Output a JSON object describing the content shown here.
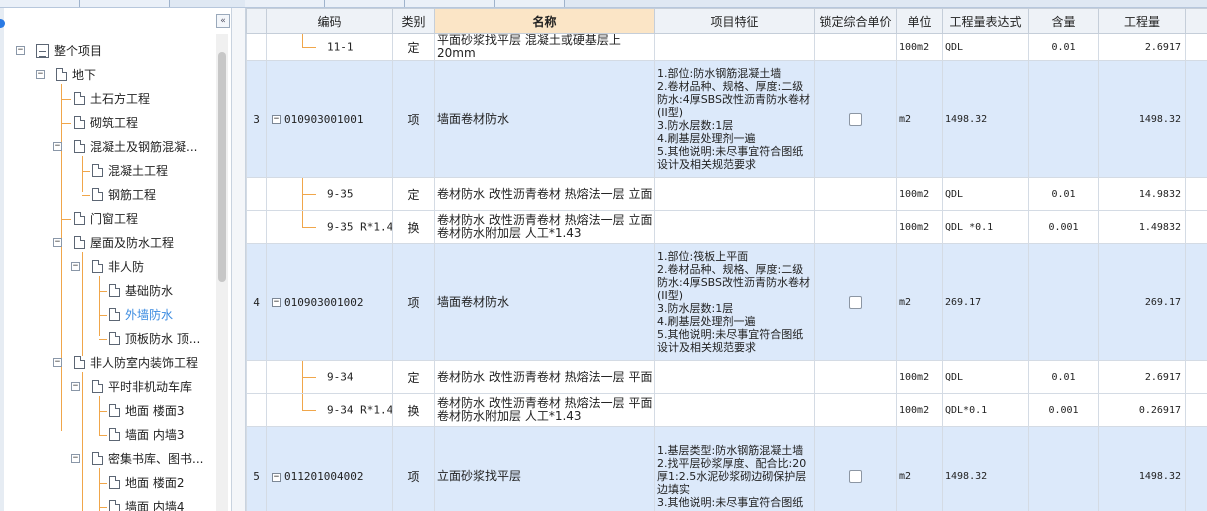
{
  "tree": {
    "collapse_glyph": "«",
    "items": [
      {
        "label": "整个项目",
        "toggle": "−"
      },
      {
        "label": "地下",
        "toggle": "−"
      },
      {
        "label": "土石方工程"
      },
      {
        "label": "砌筑工程"
      },
      {
        "label": "混凝土及钢筋混凝...",
        "toggle": "−"
      },
      {
        "label": "混凝土工程"
      },
      {
        "label": "钢筋工程"
      },
      {
        "label": "门窗工程"
      },
      {
        "label": "屋面及防水工程",
        "toggle": "−"
      },
      {
        "label": "非人防",
        "toggle": "−"
      },
      {
        "label": "基础防水"
      },
      {
        "label": "外墙防水",
        "active": true
      },
      {
        "label": "顶板防水 顶..."
      },
      {
        "label": "非人防室内装饰工程",
        "toggle": "−"
      },
      {
        "label": "平时非机动车库",
        "toggle": "−"
      },
      {
        "label": "地面 楼面3"
      },
      {
        "label": "墙面 内墙3"
      },
      {
        "label": "密集书库、图书...",
        "toggle": "−"
      },
      {
        "label": "地面 楼面2"
      },
      {
        "label": "墙面 内墙4"
      }
    ]
  },
  "grid": {
    "headers": {
      "code": "编码",
      "type": "类别",
      "name": "名称",
      "feature": "项目特征",
      "lock": "锁定综合单价",
      "unit": "单位",
      "expr": "工程量表达式",
      "qty": "含量",
      "amount": "工程量"
    },
    "rows": [
      {
        "num": "",
        "code": "11-1",
        "type": "定",
        "name": "平面砂浆找平层 混凝土或硬基层上 20mm",
        "feature": "",
        "unit": "100m2",
        "expr": "QDL",
        "qty": "0.01",
        "amount": "2.6917"
      },
      {
        "num": "3",
        "code": "010903001001",
        "type": "项",
        "name": "墙面卷材防水",
        "feature": "1.部位:防水钢筋混凝土墙\n2.卷材品种、规格、厚度:二级防水:4厚SBS改性沥青防水卷材(II型)\n3.防水层数:1层\n4.刷基层处理剂一遍\n5.其他说明:未尽事宜符合图纸设计及相关规范要求",
        "unit": "m2",
        "expr": "1498.32",
        "qty": "",
        "amount": "1498.32"
      },
      {
        "num": "",
        "code": "9-35",
        "type": "定",
        "name": "卷材防水 改性沥青卷材 热熔法一层 立面",
        "feature": "",
        "unit": "100m2",
        "expr": "QDL",
        "qty": "0.01",
        "amount": "14.9832"
      },
      {
        "num": "",
        "code": "9-35 R*1.43",
        "type": "换",
        "name": "卷材防水 改性沥青卷材 热熔法一层 立面  卷材防水附加层 人工*1.43",
        "feature": "",
        "unit": "100m2",
        "expr": "QDL *0.1",
        "qty": "0.001",
        "amount": "1.49832"
      },
      {
        "num": "4",
        "code": "010903001002",
        "type": "项",
        "name": "墙面卷材防水",
        "feature": "1.部位:筏板上平面\n2.卷材品种、规格、厚度:二级防水:4厚SBS改性沥青防水卷材(II型)\n3.防水层数:1层\n4.刷基层处理剂一遍\n5.其他说明:未尽事宜符合图纸设计及相关规范要求",
        "unit": "m2",
        "expr": "269.17",
        "qty": "",
        "amount": "269.17"
      },
      {
        "num": "",
        "code": "9-34",
        "type": "定",
        "name": "卷材防水 改性沥青卷材 热熔法一层 平面",
        "feature": "",
        "unit": "100m2",
        "expr": "QDL",
        "qty": "0.01",
        "amount": "2.6917"
      },
      {
        "num": "",
        "code": "9-34 R*1.43",
        "type": "换",
        "name": "卷材防水 改性沥青卷材 热熔法一层 平面  卷材防水附加层 人工*1.43",
        "feature": "",
        "unit": "100m2",
        "expr": "QDL*0.1",
        "qty": "0.001",
        "amount": "0.26917"
      },
      {
        "num": "5",
        "code": "011201004002",
        "type": "项",
        "name": "立面砂浆找平层",
        "feature": "1.基层类型:防水钢筋混凝土墙\n2.找平层砂浆厚度、配合比:20厚1:2.5水泥砂浆砌边砌保护层边填实\n3.其他说明:未尽事宜符合图纸",
        "unit": "m2",
        "expr": "1498.32",
        "qty": "",
        "amount": "1498.32"
      }
    ]
  },
  "colors": {
    "main_row": "#dce9fa",
    "header": "#eef2f7",
    "name_header": "#fbe5c6",
    "tree_line": "#f0a64a",
    "active_item": "#3b8be0"
  }
}
